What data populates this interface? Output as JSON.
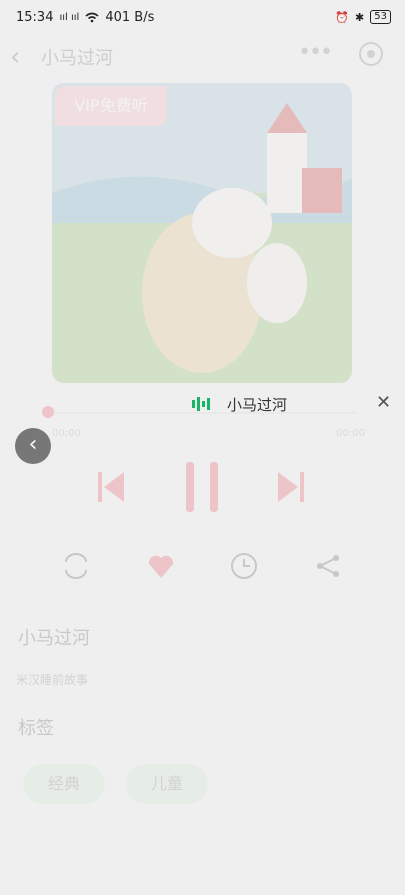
{
  "status": {
    "time": "15:34",
    "signal": "ııl ııl",
    "net_speed": "401 B/s",
    "battery": "53"
  },
  "nav": {
    "title": "小马过河"
  },
  "cover": {
    "badge": "VIP免费听"
  },
  "player": {
    "time_start": "00:00",
    "time_end": "00:00"
  },
  "info": {
    "title": "小马过河",
    "subtitle": "米汉睡前故事",
    "tags_label": "标签"
  },
  "tags": [
    "经典",
    "儿童"
  ],
  "float_bar": {
    "title": "小马过河"
  },
  "colors": {
    "accent": "#e85a6a",
    "green": "#18b566",
    "tag_bg": "#cfead0"
  }
}
